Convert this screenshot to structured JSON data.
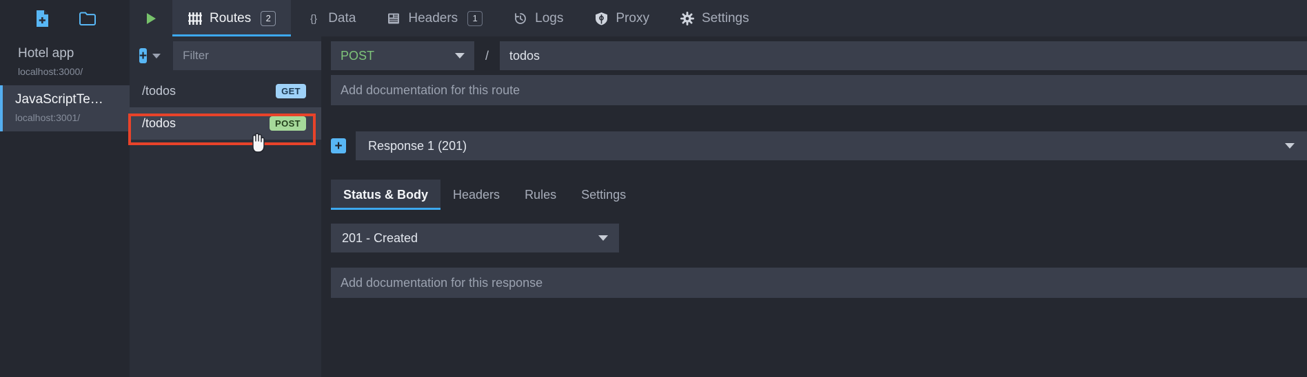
{
  "toolbar": {
    "new_file_icon": "new-file-icon",
    "open_folder_icon": "open-folder-icon",
    "start_icon": "play-icon"
  },
  "tabs": [
    {
      "id": "routes",
      "label": "Routes",
      "icon": "sliders-icon",
      "badge": "2",
      "active": true
    },
    {
      "id": "data",
      "label": "Data",
      "icon": "braces-icon",
      "badge": "",
      "active": false
    },
    {
      "id": "headers",
      "label": "Headers",
      "icon": "book-icon",
      "badge": "1",
      "active": false
    },
    {
      "id": "logs",
      "label": "Logs",
      "icon": "history-icon",
      "badge": "",
      "active": false
    },
    {
      "id": "proxy",
      "label": "Proxy",
      "icon": "shield-icon",
      "badge": "",
      "active": false
    },
    {
      "id": "settings",
      "label": "Settings",
      "icon": "gear-icon",
      "badge": "",
      "active": false
    }
  ],
  "environments": [
    {
      "name": "Hotel app",
      "url": "localhost:3000/",
      "active": false
    },
    {
      "name": "JavaScriptTe…",
      "url": "localhost:3001/",
      "active": true
    }
  ],
  "routes_panel": {
    "add_label": "+",
    "filter_placeholder": "Filter",
    "routes": [
      {
        "path": "/todos",
        "method": "GET",
        "selected": false,
        "highlighted": false
      },
      {
        "path": "/todos",
        "method": "POST",
        "selected": true,
        "highlighted": true
      }
    ]
  },
  "route_editor": {
    "method": "POST",
    "slash": "/",
    "url_value": "todos",
    "documentation_placeholder": "Add documentation for this route",
    "response_add_label": "+",
    "response_selected": "Response 1 (201)",
    "subtabs": [
      {
        "label": "Status & Body",
        "active": true
      },
      {
        "label": "Headers",
        "active": false
      },
      {
        "label": "Rules",
        "active": false
      },
      {
        "label": "Settings",
        "active": false
      }
    ],
    "status_code": "201 - Created",
    "response_documentation_placeholder": "Add documentation for this response"
  },
  "colors": {
    "accent_blue": "#3da9f0",
    "highlight_red": "#e8432a",
    "get_badge": "#9fd2f8",
    "post_badge": "#a6d99a",
    "play_green": "#77c26b"
  }
}
